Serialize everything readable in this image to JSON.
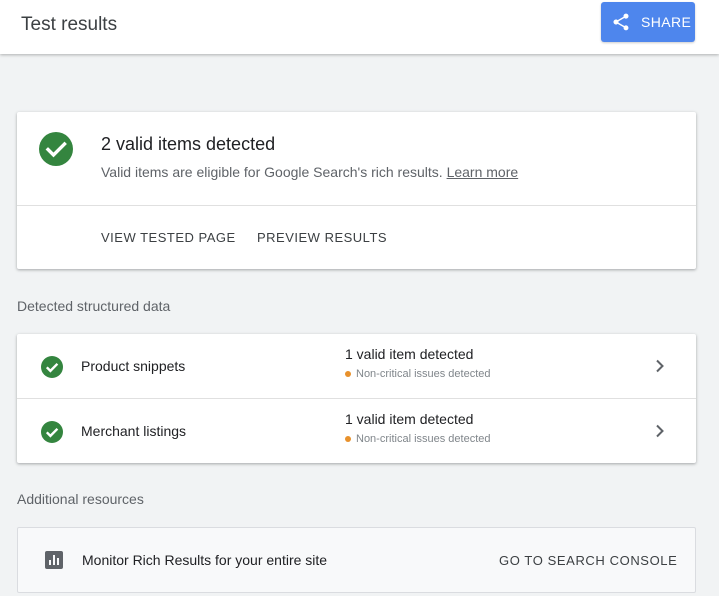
{
  "header": {
    "title": "Test results",
    "share_label": "SHARE",
    "share_color": "#4e86ed"
  },
  "summary": {
    "title": "2 valid items detected",
    "subtitle": "Valid items are eligible for Google Search's rich results.",
    "learn_more": "Learn more",
    "status_color": "#34853f",
    "actions": [
      {
        "label": "VIEW TESTED PAGE"
      },
      {
        "label": "PREVIEW RESULTS"
      }
    ]
  },
  "detected": {
    "heading": "Detected structured data",
    "items": [
      {
        "name": "Product snippets",
        "status": "1 valid item detected",
        "issue": "Non-critical issues detected"
      },
      {
        "name": "Merchant listings",
        "status": "1 valid item detected",
        "issue": "Non-critical issues detected"
      }
    ],
    "issue_color": "#e8912c"
  },
  "resources": {
    "heading": "Additional resources",
    "text": "Monitor Rich Results for your entire site",
    "action": "GO TO SEARCH CONSOLE",
    "icon": "bar-chart-icon"
  }
}
